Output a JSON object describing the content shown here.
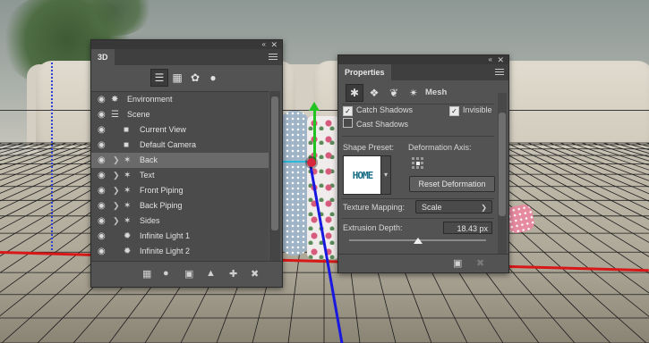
{
  "panel3d": {
    "tab": "3D",
    "layers": [
      {
        "name": "Environment",
        "type": "environment-icon",
        "chevron": false,
        "selected": false
      },
      {
        "name": "Scene",
        "type": "scene-icon",
        "chevron": false,
        "selected": false
      },
      {
        "name": "Current View",
        "type": "camera-icon",
        "chevron": false,
        "selected": false
      },
      {
        "name": "Default Camera",
        "type": "camera-icon",
        "chevron": false,
        "selected": false
      },
      {
        "name": "Back",
        "type": "mesh-icon",
        "chevron": true,
        "selected": true
      },
      {
        "name": "Text",
        "type": "mesh-icon",
        "chevron": true,
        "selected": false
      },
      {
        "name": "Front Piping",
        "type": "mesh-icon",
        "chevron": true,
        "selected": false
      },
      {
        "name": "Back Piping",
        "type": "mesh-icon",
        "chevron": true,
        "selected": false
      },
      {
        "name": "Sides",
        "type": "mesh-icon",
        "chevron": true,
        "selected": false
      },
      {
        "name": "Infinite Light 1",
        "type": "light-icon",
        "chevron": false,
        "selected": false
      },
      {
        "name": "Infinite Light 2",
        "type": "light-icon",
        "chevron": false,
        "selected": false
      }
    ]
  },
  "properties": {
    "tab": "Properties",
    "mode_label": "Mesh",
    "catch_shadows": "Catch Shadows",
    "invisible": "Invisible",
    "cast_shadows": "Cast Shadows",
    "shape_preset_label": "Shape Preset:",
    "preset_preview_text": "HOME",
    "deformation_axis_label": "Deformation Axis:",
    "reset_deformation": "Reset Deformation",
    "texture_mapping_label": "Texture Mapping:",
    "texture_mapping_value": "Scale",
    "extrusion_depth_label": "Extrusion Depth:",
    "extrusion_depth_value": "18.43 px",
    "extrusion_slider_fraction": 0.5
  },
  "colors": {
    "panel_bg": "#535353",
    "selected_row": "#6a6a6a",
    "x_axis": "#d81818",
    "y_axis": "#22c222",
    "z_axis": "#1818e0"
  }
}
